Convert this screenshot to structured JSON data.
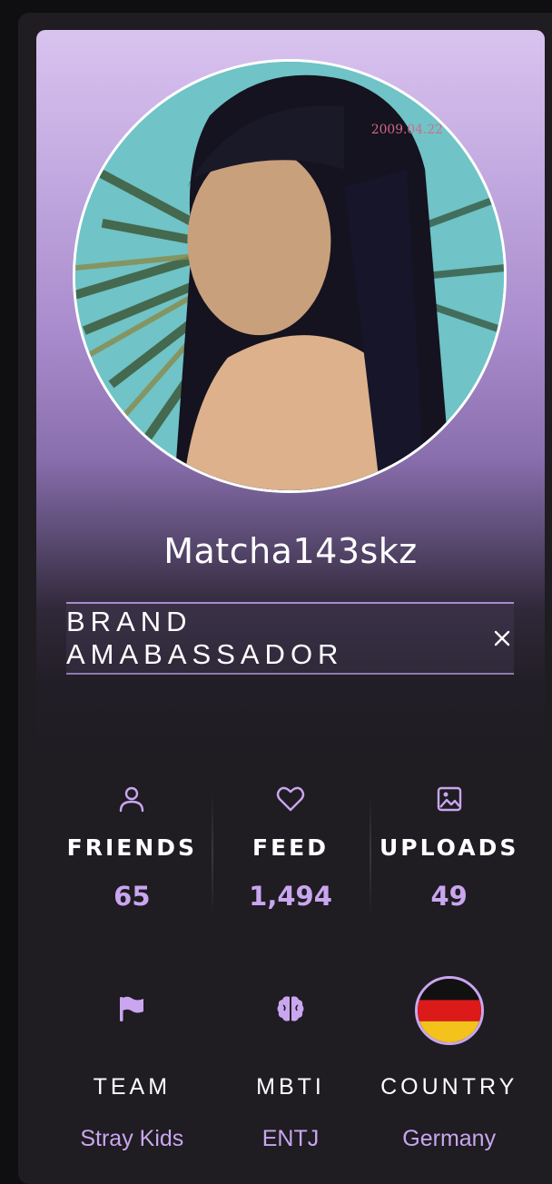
{
  "profile": {
    "username": "Matcha143skz",
    "badge_label": "BRAND AMABASSADOR",
    "badge_close_icon": "close-icon",
    "avatar_icon": "profile-photo",
    "colors": {
      "accent": "#c9a6ef",
      "card_top": "#d9c3ef",
      "background": "#1f1c22"
    }
  },
  "stats": [
    {
      "icon": "person-icon",
      "label": "FRIENDS",
      "value": "65"
    },
    {
      "icon": "heart-icon",
      "label": "FEED",
      "value": "1,494"
    },
    {
      "icon": "image-icon",
      "label": "UPLOADS",
      "value": "49"
    }
  ],
  "info": [
    {
      "icon": "flag-icon",
      "label": "TEAM",
      "value": "Stray Kids"
    },
    {
      "icon": "brain-icon",
      "label": "MBTI",
      "value": "ENTJ"
    },
    {
      "icon": "germany-flag-icon",
      "label": "COUNTRY",
      "value": "Germany"
    }
  ]
}
